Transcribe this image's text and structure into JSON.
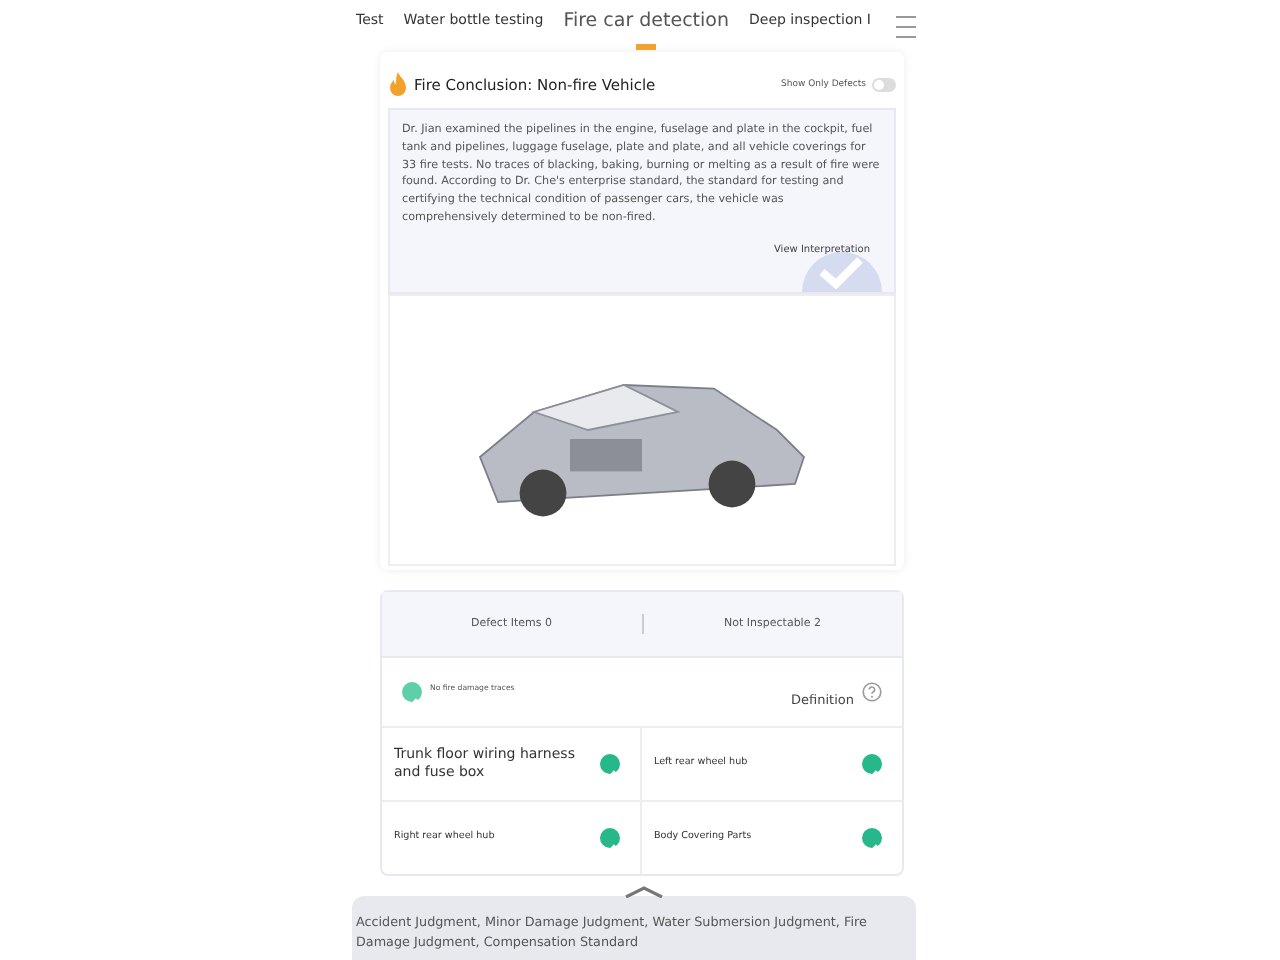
{
  "tabs": [
    {
      "label": "Test",
      "selected": false
    },
    {
      "label": "Water bottle testing",
      "selected": false
    },
    {
      "label": "Fire car detection",
      "selected": true
    },
    {
      "label": "Deep inspection I",
      "selected": false
    }
  ],
  "conclusion": {
    "title": "Fire Conclusion: Non-fire Vehicle",
    "toggle": {
      "label": "Show Only Defects",
      "on": false
    }
  },
  "report": {
    "text": "Dr. Jian examined the pipelines in the engine, fuselage and plate in the cockpit, fuel tank and pipelines, luggage fuselage, plate and plate, and all vehicle coverings for 33 fire tests. No traces of blacking, baking, burning or melting as a result of fire were found. According to Dr. Che's enterprise standard, the standard for testing and certifying the technical condition of passenger cars, the vehicle was comprehensively determined to be non-fired.",
    "link": "View Interpretation"
  },
  "stats": [
    {
      "label": "Defect Items 0"
    },
    {
      "label": "Not Inspectable 2"
    }
  ],
  "summary": {
    "label": "No fire damage traces",
    "checked": true,
    "definition": "Definition"
  },
  "items": [
    {
      "label": "Trunk floor wiring harness and fuse box",
      "kind": "large",
      "checked": true
    },
    {
      "label": "Left rear wheel hub",
      "kind": "small",
      "checked": true
    },
    {
      "label": "Right rear wheel hub",
      "kind": "small",
      "checked": true
    },
    {
      "label": "Body Covering Parts",
      "kind": "small",
      "checked": true
    }
  ],
  "bottom_sheet": {
    "text": "Accident Judgment, Minor Damage Judgment, Water Submersion Judgment, Fire Damage Judgment, Compensation Standard"
  }
}
